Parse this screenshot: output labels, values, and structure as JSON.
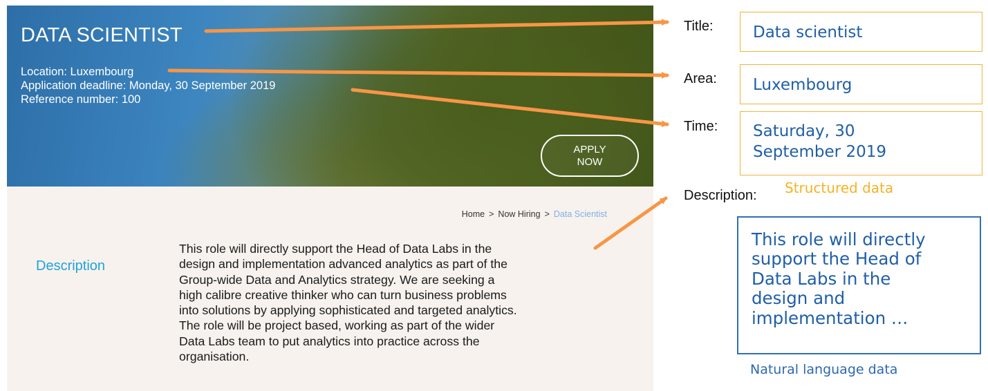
{
  "job_page": {
    "title": "DATA SCIENTIST",
    "location": "Location: Luxembourg",
    "deadline": "Application deadline: Monday, 30 September 2019",
    "reference": "Reference number: 100",
    "apply_button": [
      "APPLY",
      "NOW"
    ],
    "breadcrumb": {
      "home": "Home",
      "separator": ">",
      "section": "Now Hiring",
      "current": "Data Scientist"
    },
    "description_label": "Description",
    "description_lines": [
      "This role will directly support the Head of Data Labs in the",
      "design and implementation advanced analytics as part of the",
      "Group-wide Data and Analytics strategy. We are seeking a",
      "high calibre creative thinker who can turn business problems",
      "into solutions by applying sophisticated and targeted analytics.",
      "The role will be project based, working as part of the wider",
      "Data Labs team to put analytics into practice across the",
      "organisation."
    ]
  },
  "structured": {
    "title_label": "Title:",
    "title_value": "Data scientist",
    "area_label": "Area:",
    "area_value": "Luxembourg",
    "time_label": "Time:",
    "time_value": [
      "Saturday, 30",
      "September 2019"
    ],
    "description_label": "Description:",
    "caption": "Structured data"
  },
  "natural_language": {
    "lines": [
      "This role will directly",
      "support the Head of",
      "Data Labs in the",
      "design and",
      "implementation …"
    ],
    "caption": "Natural language data"
  },
  "colors": {
    "arrow": "#f79646",
    "structured_border": "#f0b43c",
    "nl_border": "#2f6fb5",
    "value_text": "#1f5fa8",
    "description_label": "#1ea3dc"
  }
}
